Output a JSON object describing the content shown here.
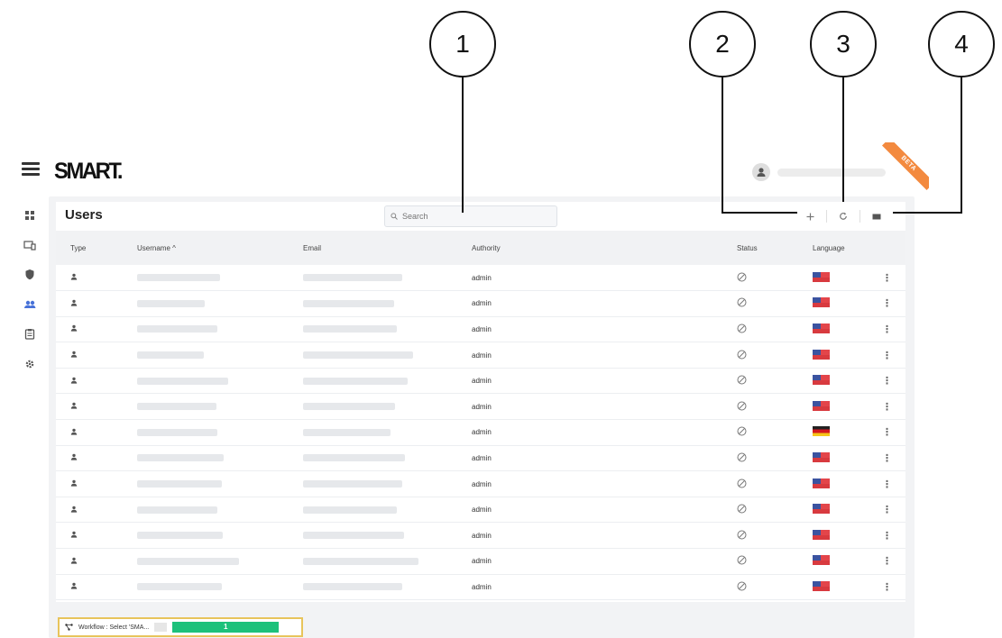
{
  "callouts": [
    "1",
    "2",
    "3",
    "4"
  ],
  "header": {
    "logo": "SMART.",
    "beta_label": "BETA"
  },
  "page": {
    "title": "Users"
  },
  "search": {
    "placeholder": "Search"
  },
  "toolbar": {
    "add_icon": "plus-icon",
    "refresh_icon": "refresh-icon",
    "columns_icon": "columns-icon"
  },
  "sidebar": {
    "items": [
      "dashboard-icon",
      "devices-icon",
      "security-icon",
      "users-icon",
      "clipboard-icon",
      "settings-icon"
    ],
    "active": "users-icon"
  },
  "table": {
    "columns": [
      "Type",
      "Username ^",
      "Email",
      "Authority",
      "Status",
      "Language"
    ],
    "rows": [
      {
        "authority": "admin",
        "flag": "us"
      },
      {
        "authority": "admin",
        "flag": "us"
      },
      {
        "authority": "admin",
        "flag": "us"
      },
      {
        "authority": "admin",
        "flag": "us"
      },
      {
        "authority": "admin",
        "flag": "us"
      },
      {
        "authority": "admin",
        "flag": "us"
      },
      {
        "authority": "admin",
        "flag": "de"
      },
      {
        "authority": "admin",
        "flag": "us"
      },
      {
        "authority": "admin",
        "flag": "us"
      },
      {
        "authority": "admin",
        "flag": "us"
      },
      {
        "authority": "admin",
        "flag": "us"
      },
      {
        "authority": "admin",
        "flag": "us"
      },
      {
        "authority": "admin",
        "flag": "us"
      }
    ]
  },
  "workflow": {
    "label": "Workflow : Select 'SMA...",
    "count": "1"
  },
  "colors": {
    "accent": "#4872d8",
    "beta": "#f38a3f",
    "workflow_border": "#e8c45b",
    "workflow_button": "#1cc17b"
  }
}
